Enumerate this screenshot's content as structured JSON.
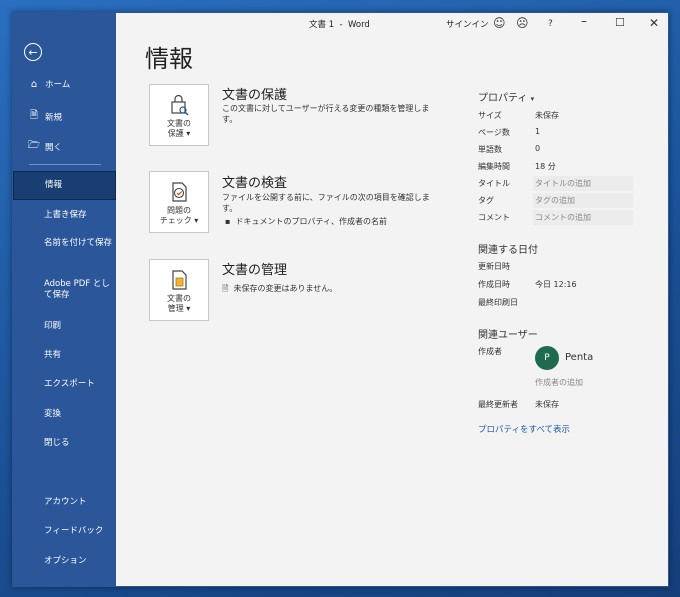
{
  "titlebar": {
    "title": "文書 1  -  Word",
    "signin": "サインイン"
  },
  "sidebar": {
    "nav": [
      {
        "label": "ホーム",
        "icon": "home-icon"
      },
      {
        "label": "新規",
        "icon": "new-document-icon"
      },
      {
        "label": "開く",
        "icon": "folder-open-icon"
      }
    ],
    "items": [
      "情報",
      "上書き保存",
      "名前を付けて保存",
      "Adobe PDF として保存",
      "印刷",
      "共有",
      "エクスポート",
      "変換",
      "閉じる"
    ],
    "bottom": [
      "アカウント",
      "フィードバック",
      "オプション"
    ],
    "active": "情報"
  },
  "main": {
    "title": "情報",
    "sections": [
      {
        "button": "文書の\n保護",
        "title": "文書の保護",
        "desc": "この文書に対してユーザーが行える変更の種類を管理します。",
        "icon": "lock-document-icon"
      },
      {
        "button": "問題の\nチェック",
        "title": "文書の検査",
        "desc": "ファイルを公開する前に、ファイルの次の項目を確認します。",
        "bullet": "ドキュメントのプロパティ、作成者の名前",
        "icon": "inspect-document-icon"
      },
      {
        "button": "文書の\n管理",
        "title": "文書の管理",
        "desc": "未保存の変更はありません。",
        "icon": "manage-document-icon"
      }
    ]
  },
  "properties": {
    "heading": "プロパティ",
    "rows": [
      {
        "key": "サイズ",
        "value": "未保存"
      },
      {
        "key": "ページ数",
        "value": "1"
      },
      {
        "key": "単語数",
        "value": "0"
      },
      {
        "key": "編集時間",
        "value": "18 分"
      },
      {
        "key": "タイトル",
        "value": "タイトルの追加",
        "hint": true
      },
      {
        "key": "タグ",
        "value": "タグの追加",
        "hint": true
      },
      {
        "key": "コメント",
        "value": "コメントの追加",
        "hint": true
      }
    ],
    "dates_heading": "関連する日付",
    "dates": [
      {
        "key": "更新日時",
        "value": ""
      },
      {
        "key": "作成日時",
        "value": "今日 12:16"
      },
      {
        "key": "最終印刷日",
        "value": ""
      }
    ],
    "people_heading": "関連ユーザー",
    "author_label": "作成者",
    "author_initial": "P",
    "author_name": "Penta",
    "add_author": "作成者の追加",
    "last_modified_label": "最終更新者",
    "last_modified_value": "未保存",
    "show_all": "プロパティをすべて表示"
  },
  "colors": {
    "sidebar": "#2b579a",
    "active": "#193f72",
    "avatar": "#1f6b4f"
  }
}
